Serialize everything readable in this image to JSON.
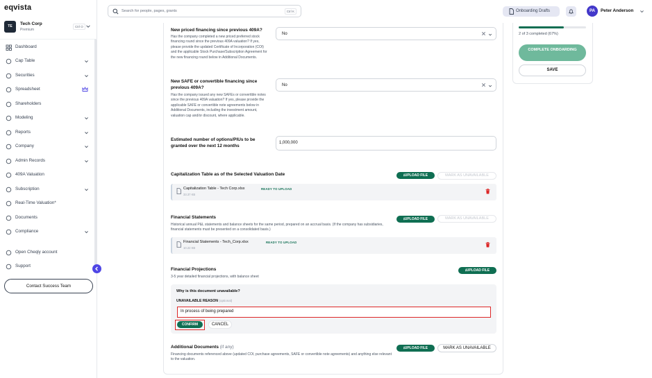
{
  "app": {
    "logo": "eqvista"
  },
  "company": {
    "initials": "TE",
    "name": "Tech Corp",
    "plan": "Premium",
    "shortcut": "Ctrl O"
  },
  "sidebar": {
    "items": [
      {
        "label": "Dashboard",
        "icon": "dashboard-icon",
        "chevron": false
      },
      {
        "label": "Cap Table",
        "icon": "cap-table-icon",
        "chevron": true
      },
      {
        "label": "Securities",
        "icon": "securities-icon",
        "chevron": true
      },
      {
        "label": "Spreadsheet",
        "icon": "spreadsheet-icon",
        "chevron": false,
        "crown": true
      },
      {
        "label": "Shareholders",
        "icon": "shareholders-icon",
        "chevron": false
      },
      {
        "label": "Modeling",
        "icon": "modeling-icon",
        "chevron": true
      },
      {
        "label": "Reports",
        "icon": "reports-icon",
        "chevron": true
      },
      {
        "label": "Company",
        "icon": "company-icon",
        "chevron": true
      },
      {
        "label": "Admin Records",
        "icon": "admin-records-icon",
        "chevron": true
      },
      {
        "label": "409A Valuation",
        "icon": "valuation-icon",
        "chevron": false
      },
      {
        "label": "Subscription",
        "icon": "subscription-icon",
        "chevron": true
      },
      {
        "label": "Real-Time Valuation*",
        "icon": "realtime-icon",
        "chevron": false
      },
      {
        "label": "Documents",
        "icon": "documents-icon",
        "chevron": false
      },
      {
        "label": "Compliance",
        "icon": "compliance-icon",
        "chevron": true
      },
      {
        "label": "Open Cheqly account",
        "icon": "cheqly-icon",
        "chevron": false
      },
      {
        "label": "Support",
        "icon": "support-icon",
        "chevron": false
      }
    ],
    "contact_label": "Contact Success Team"
  },
  "header": {
    "search_placeholder": "Search for people, pages, grants",
    "search_shortcut": "Ctrl K",
    "drafts_label": "Onboarding Drafts",
    "user_initials": "PA",
    "user_name": "Peter Anderson"
  },
  "questions": {
    "priced": {
      "title": "New priced financing since previous 409A?",
      "help": "Has the company completed a new priced preferred stock financing round since the previous 409A valuation? If yes, please provide the updated Certificate of Incorporation (COI) and the applicable Stock Purchase/Subscription Agreement for the new financing round below in Additional Documents.",
      "value": "No"
    },
    "safe": {
      "title": "New SAFE or convertible financing since previous 409A?",
      "help": "Has the company issued any new SAFEs or convertible notes since the previous 409A valuation? If yes, please provide the applicable SAFE or convertible note agreements below in Additional Documents, including the investment amount, valuation cap and/or discount, where applicable.",
      "value": "No"
    },
    "options": {
      "title": "Estimated number of options/PIUs to be granted over the next 12 months",
      "value": "1,000,000"
    }
  },
  "documents": {
    "cap_table": {
      "title": "Capitalization Table as of the Selected Valuation Date",
      "upload_label": "UPLOAD FILE",
      "mark_label": "MARK AS UNAVAILABLE",
      "file": {
        "name": "Capitalization Table - Tech Corp.xlsx",
        "size": "33.37 KB",
        "status": "READY TO UPLOAD"
      }
    },
    "financials": {
      "title": "Financial Statements",
      "desc": "Historical annual P&L statements and balance sheets for the same period, prepared on an accrual basis. (If the company has subsidiaries, financial statements must be presented on a consolidated basis.)",
      "upload_label": "UPLOAD FILE",
      "mark_label": "MARK AS UNAVAILABLE",
      "file": {
        "name": "Financial Statements - Tech_Corp.xlsx",
        "size": "10.22 KB",
        "status": "READY TO UPLOAD"
      }
    },
    "projections": {
      "title": "Financial Projections",
      "desc": "3-5 year detailed financial projections, with balance sheet",
      "upload_label": "UPLOAD FILE",
      "unavailable": {
        "question": "Why is this document unavailable?",
        "label": "UNAVAILABLE REASON",
        "optional": "(optional)",
        "reason": "In process of being prepared",
        "confirm_label": "CONFIRM",
        "cancel_label": "CANCEL"
      }
    },
    "additional": {
      "title": "Additional Documents",
      "optional": "(if any)",
      "desc": "Financing documents referenced above (updated COI, purchase agreements, SAFE or convertible note agreements) and anything else relevant to the valuation.",
      "upload_label": "UPLOAD FILE",
      "mark_label": "MARK AS UNAVAILABLE"
    }
  },
  "progress": {
    "fraction": 0.67,
    "text": "2 of 3 completed (67%)",
    "complete_label": "COMPLETE ONBOARDING",
    "save_label": "SAVE"
  },
  "colors": {
    "accent": "#0f6e52",
    "accent_light": "#6fb99c",
    "brand": "#4338ca",
    "error": "#dc2626"
  }
}
